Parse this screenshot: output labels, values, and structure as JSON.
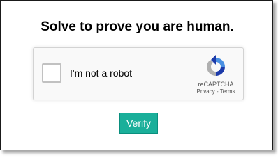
{
  "dialog": {
    "title": "Solve to prove you are human."
  },
  "captcha": {
    "checkbox_label": "I'm not a robot",
    "checked": false,
    "brand": "reCAPTCHA",
    "privacy_link": "Privacy",
    "separator": " - ",
    "terms_link": "Terms",
    "logo_icon": "recaptcha-logo-icon",
    "colors": {
      "logo_blue": "#4a90e2",
      "logo_dark_blue": "#1c3aa9",
      "logo_gray": "#b0b0b0"
    }
  },
  "actions": {
    "verify_label": "Verify",
    "verify_color": "#1aaf9a"
  }
}
